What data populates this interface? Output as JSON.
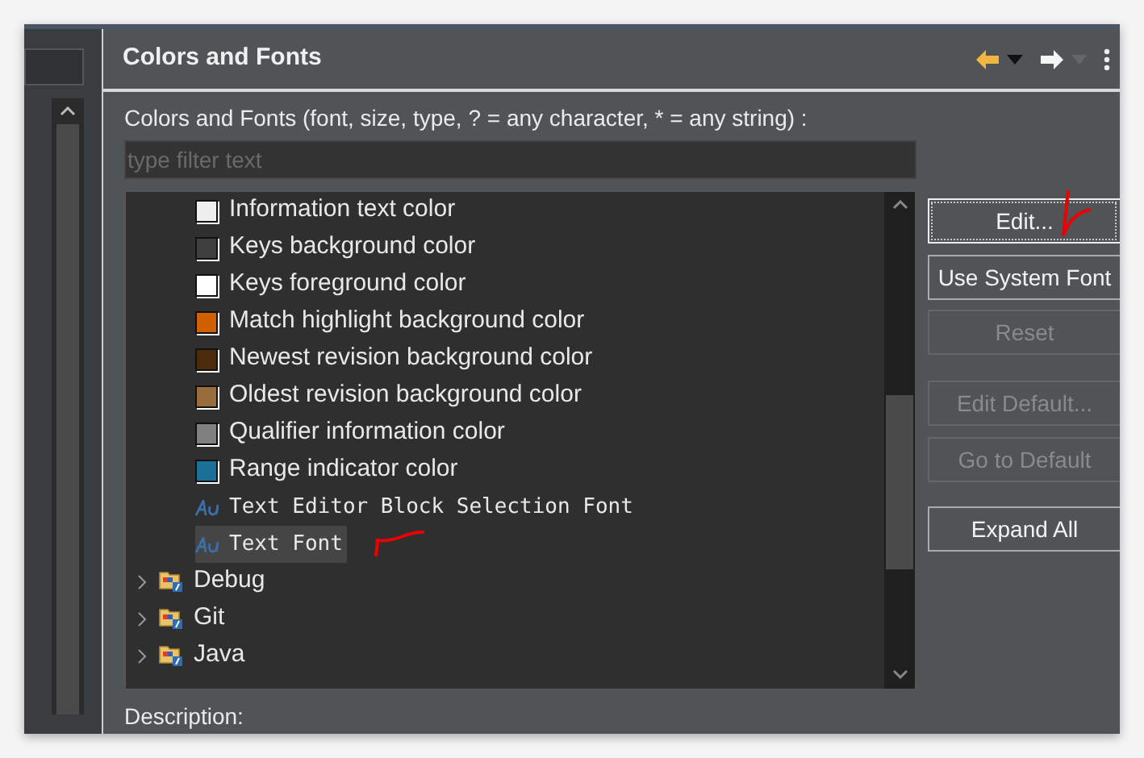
{
  "panel": {
    "title": "Colors and Fonts"
  },
  "filter": {
    "label": "Colors and Fonts (font, size, type, ? = any character, * = any string) :",
    "placeholder": "type filter text"
  },
  "tree": [
    {
      "kind": "color",
      "label": "Information text color",
      "color": "#eeeeee",
      "selected": false
    },
    {
      "kind": "color",
      "label": "Keys background color",
      "color": "#3f3f3f",
      "selected": false
    },
    {
      "kind": "color",
      "label": "Keys foreground color",
      "color": "#ffffff",
      "selected": false
    },
    {
      "kind": "color",
      "label": "Match highlight background color",
      "color": "#d06000",
      "selected": false
    },
    {
      "kind": "color",
      "label": "Newest revision background color",
      "color": "#4a2c0a",
      "selected": false
    },
    {
      "kind": "color",
      "label": "Oldest revision background color",
      "color": "#9a6c3c",
      "selected": false
    },
    {
      "kind": "color",
      "label": "Qualifier information color",
      "color": "#808080",
      "selected": false
    },
    {
      "kind": "color",
      "label": "Range indicator color",
      "color": "#1a7096",
      "selected": false
    },
    {
      "kind": "font",
      "label": "Text Editor Block Selection Font",
      "selected": false
    },
    {
      "kind": "font",
      "label": "Text Font",
      "selected": true
    },
    {
      "kind": "category",
      "label": "Debug",
      "expanded": false,
      "selected": false
    },
    {
      "kind": "category",
      "label": "Git",
      "expanded": false,
      "selected": false
    },
    {
      "kind": "category",
      "label": "Java",
      "expanded": false,
      "selected": false
    }
  ],
  "buttons": [
    {
      "label": "Edit...",
      "disabled": false,
      "focused": true
    },
    {
      "label": "Use System Font",
      "disabled": false,
      "focused": false
    },
    {
      "label": "Reset",
      "disabled": true,
      "focused": false
    },
    {
      "label": "Edit Default...",
      "disabled": true,
      "focused": false
    },
    {
      "label": "Go to Default",
      "disabled": true,
      "focused": false
    },
    {
      "label": "Expand All",
      "disabled": false,
      "focused": false
    }
  ],
  "description_label": "Description:"
}
